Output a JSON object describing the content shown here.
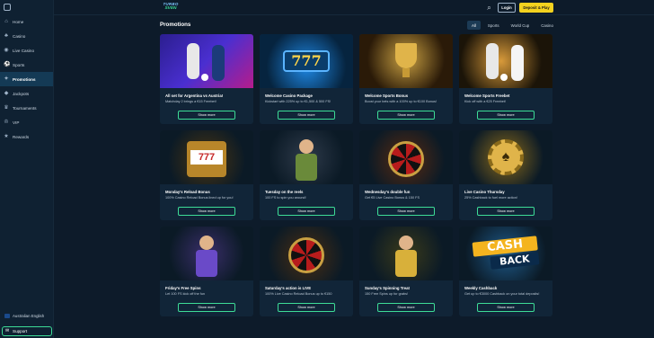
{
  "header": {
    "logo_line1": "TURBO",
    "logo_line2": "SVEN",
    "login_label": "Login",
    "deposit_label": "Deposit & Play"
  },
  "sidebar": {
    "items": [
      {
        "label": "Home",
        "icon": "home-icon"
      },
      {
        "label": "Casino",
        "icon": "casino-icon"
      },
      {
        "label": "Live Casino",
        "icon": "live-casino-icon"
      },
      {
        "label": "Sports",
        "icon": "sports-icon"
      },
      {
        "label": "Promotions",
        "icon": "gift-icon",
        "active": true
      },
      {
        "label": "Jackpots",
        "icon": "jackpot-icon"
      },
      {
        "label": "Tournaments",
        "icon": "trophy-icon"
      },
      {
        "label": "VIP",
        "icon": "crown-icon"
      },
      {
        "label": "Rewards",
        "icon": "rewards-icon"
      }
    ],
    "language": "Australian English",
    "support": "Support"
  },
  "main": {
    "title": "Promotions",
    "filters": [
      "All",
      "Sports",
      "World Cup",
      "Casino"
    ],
    "active_filter": "All",
    "cards": [
      {
        "title": "All set for Argentina vs Austria!",
        "desc": "Matchday 2 brings a €15 Freebet!",
        "button": "Show more",
        "theme": "sports-soccer"
      },
      {
        "title": "Welcome Casino Package",
        "desc": "Kickstart with 225% up to €1,500 & 500 FS!",
        "button": "Show more",
        "theme": "slots-777"
      },
      {
        "title": "Welcome Sports Bonus",
        "desc": "Boost your bets with a 100% up to €100 Bonus!",
        "button": "Show more",
        "theme": "trophy"
      },
      {
        "title": "Welcome Sports Freebet",
        "desc": "Kick off with a €25 Freebet!",
        "button": "Show more",
        "theme": "soccer-kick"
      },
      {
        "title": "Monday's Reload Bonus",
        "desc": "100% Casino Reload Bonus lined up for you!",
        "button": "Show more",
        "theme": "slot-machine"
      },
      {
        "title": "Tuesday on the reels",
        "desc": "100 FS to spin you around!",
        "button": "Show more",
        "theme": "cowboy"
      },
      {
        "title": "Wednesday's double fun",
        "desc": "Get €5 Live Casino Bonus & 150 FS",
        "button": "Show more",
        "theme": "roulette"
      },
      {
        "title": "Live Casino Thursday",
        "desc": "25% Cashback to fuel more action!",
        "button": "Show more",
        "theme": "chip"
      },
      {
        "title": "Friday's Free Spins",
        "desc": "Let 100 FS kick off the fun",
        "button": "Show more",
        "theme": "wizard"
      },
      {
        "title": "Saturday's action is LIVE",
        "desc": "100% Live Casino Reload Bonus up to €150",
        "button": "Show more",
        "theme": "roulette-wheel"
      },
      {
        "title": "Sunday's Spinning Treat",
        "desc": "150 Free Spins up for grabs!",
        "button": "Show more",
        "theme": "farmer"
      },
      {
        "title": "Weekly Cashback",
        "desc": "Get up to €3000 Cashback on your total deposits!",
        "button": "Show more",
        "theme": "cashback",
        "art_text1": "CASH",
        "art_text2": "BACK"
      }
    ]
  },
  "colors": {
    "accent_green": "#3ddc97",
    "deposit_yellow": "#f4d21f",
    "bg": "#0d1b2a",
    "card_bg": "#112538"
  }
}
